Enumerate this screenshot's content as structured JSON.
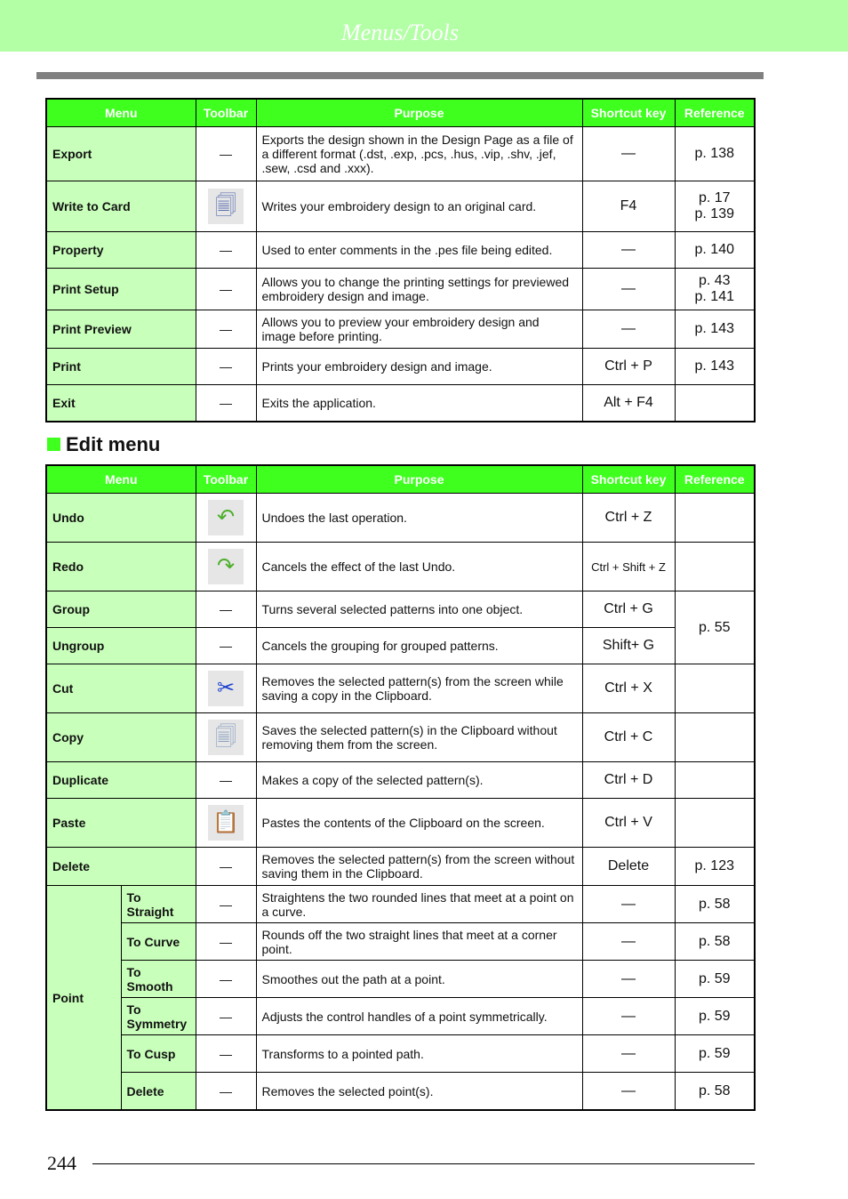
{
  "header": {
    "title": "Menus/Tools"
  },
  "columns": [
    "Menu",
    "Toolbar",
    "Purpose",
    "Shortcut key",
    "Reference"
  ],
  "file_rows": [
    {
      "menu": "Export",
      "toolbar": "—",
      "purpose": "Exports the design shown in the Design Page as a file of a different format (.dst, .exp, .pcs, .hus, .vip, .shv, .jef, .sew, .csd and .xxx).",
      "shortcut": "—",
      "ref": "p. 138"
    },
    {
      "menu": "Write to Card",
      "toolbar": "write-to-card-icon",
      "purpose": "Writes your embroidery design to an original card.",
      "shortcut": "F4",
      "ref": "p. 17\np. 139"
    },
    {
      "menu": "Property",
      "toolbar": "—",
      "purpose": "Used to enter comments in the .pes file being edited.",
      "shortcut": "—",
      "ref": "p. 140"
    },
    {
      "menu": "Print Setup",
      "toolbar": "—",
      "purpose": "Allows you to change the printing settings for previewed embroidery design and image.",
      "shortcut": "—",
      "ref": "p. 43\np. 141"
    },
    {
      "menu": "Print Preview",
      "toolbar": "—",
      "purpose": "Allows you to preview your embroidery design and image before printing.",
      "shortcut": "—",
      "ref": "p. 143"
    },
    {
      "menu": "Print",
      "toolbar": "—",
      "purpose": "Prints your embroidery design and image.",
      "shortcut": "Ctrl + P",
      "ref": "p. 143"
    },
    {
      "menu": "Exit",
      "toolbar": "—",
      "purpose": "Exits the application.",
      "shortcut": "Alt + F4",
      "ref": ""
    }
  ],
  "edit_section": {
    "title": "Edit menu"
  },
  "edit_rows": [
    {
      "menu": "Undo",
      "toolbar": "undo-icon",
      "purpose": "Undoes the last operation.",
      "shortcut": "Ctrl + Z",
      "ref": ""
    },
    {
      "menu": "Redo",
      "toolbar": "redo-icon",
      "purpose": "Cancels the effect of the last Undo.",
      "shortcut": "Ctrl + Shift + Z",
      "ref": ""
    },
    {
      "menu": "Group",
      "toolbar": "—",
      "purpose": "Turns several selected patterns into one object.",
      "shortcut": "Ctrl + G",
      "ref": "p. 55"
    },
    {
      "menu": "Ungroup",
      "toolbar": "—",
      "purpose": "Cancels the grouping for grouped patterns.",
      "shortcut": "Shift+ G",
      "ref": ""
    },
    {
      "menu": "Cut",
      "toolbar": "cut-icon",
      "purpose": "Removes the selected pattern(s) from the screen while saving a copy in the Clipboard.",
      "shortcut": "Ctrl + X",
      "ref": ""
    },
    {
      "menu": "Copy",
      "toolbar": "copy-icon",
      "purpose": "Saves the selected pattern(s) in the Clipboard without removing them from the screen.",
      "shortcut": "Ctrl + C",
      "ref": ""
    },
    {
      "menu": "Duplicate",
      "toolbar": "—",
      "purpose": "Makes a copy of the selected pattern(s).",
      "shortcut": "Ctrl + D",
      "ref": ""
    },
    {
      "menu": "Paste",
      "toolbar": "paste-icon",
      "purpose": "Pastes the contents of the Clipboard on the screen.",
      "shortcut": "Ctrl + V",
      "ref": ""
    },
    {
      "menu": "Delete",
      "toolbar": "—",
      "purpose": "Removes the selected pattern(s) from the screen without saving them in the Clipboard.",
      "shortcut": "Delete",
      "ref": "p. 123"
    }
  ],
  "point": {
    "label": "Point",
    "rows": [
      {
        "menu": "To Straight",
        "toolbar": "—",
        "purpose": "Straightens the two rounded lines that meet at a point on a curve.",
        "shortcut": "—",
        "ref": "p. 58"
      },
      {
        "menu": "To Curve",
        "toolbar": "—",
        "purpose": "Rounds off the two straight lines that meet at a corner point.",
        "shortcut": "—",
        "ref": "p. 58"
      },
      {
        "menu": "To Smooth",
        "toolbar": "—",
        "purpose": "Smoothes out the path at a point.",
        "shortcut": "—",
        "ref": "p. 59"
      },
      {
        "menu": "To Symmetry",
        "toolbar": "—",
        "purpose": "Adjusts the control handles of a point symmetrically.",
        "shortcut": "—",
        "ref": "p. 59"
      },
      {
        "menu": "To Cusp",
        "toolbar": "—",
        "purpose": "Transforms to a pointed path.",
        "shortcut": "—",
        "ref": "p. 59"
      },
      {
        "menu": "Delete",
        "toolbar": "—",
        "purpose": "Removes the selected point(s).",
        "shortcut": "—",
        "ref": "p. 58"
      }
    ]
  },
  "footer": {
    "page_number": "244"
  }
}
